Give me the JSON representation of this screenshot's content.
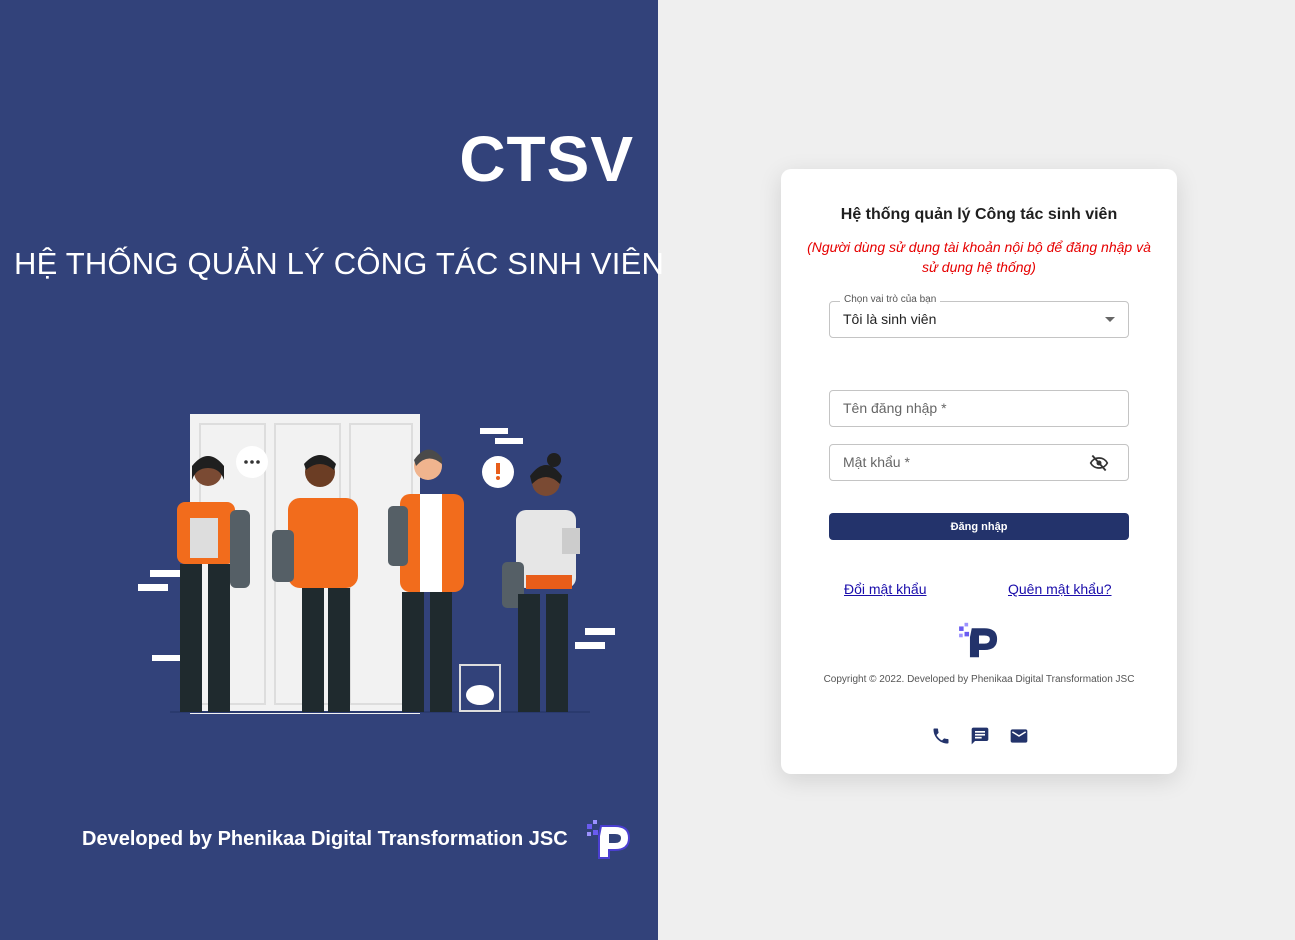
{
  "left": {
    "brand": "CTSV",
    "tagline": "HỆ THỐNG QUẢN LÝ CÔNG TÁC SINH VIÊN",
    "developer": "Developed by Phenikaa Digital Transformation JSC"
  },
  "login": {
    "title": "Hệ thống quản lý Công tác sinh viên",
    "note": "(Người dùng sử dụng tài khoản nội bộ để đăng nhập và sử dụng hệ thống)",
    "role_label": "Chọn vai trò của bạn",
    "role_value": "Tôi là sinh viên",
    "username_placeholder": "Tên đăng nhập *",
    "password_placeholder": "Mật khẩu *",
    "submit_label": "Đăng nhập",
    "change_password": "Đổi mật khẩu",
    "forgot_password": "Quên mật khẩu?",
    "copyright": "Copyright © 2022. Developed by Phenikaa Digital Transformation JSC"
  },
  "icons": {
    "password_toggle": "eye-off-icon",
    "phone": "phone-icon",
    "chat": "chat-icon",
    "mail": "mail-icon"
  },
  "colors": {
    "left_bg": "#32427a",
    "primary": "#23336b",
    "note": "#e60000",
    "link": "#1a0dab"
  }
}
